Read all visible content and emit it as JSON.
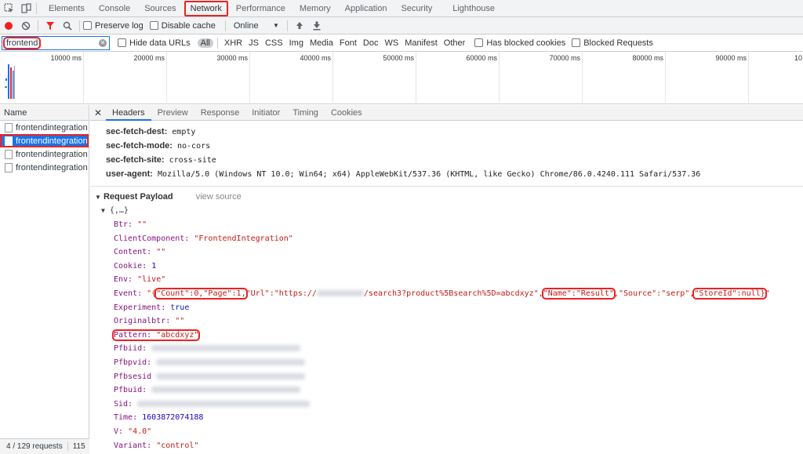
{
  "top_tabs": [
    "Elements",
    "Console",
    "Sources",
    "Network",
    "Performance",
    "Memory",
    "Application",
    "Security",
    "Lighthouse"
  ],
  "toolbar": {
    "preserve_log": "Preserve log",
    "disable_cache": "Disable cache",
    "throttle": "Online"
  },
  "filter": {
    "value": "frontend",
    "hide_data_urls": "Hide data URLs",
    "types": [
      "All",
      "XHR",
      "JS",
      "CSS",
      "Img",
      "Media",
      "Font",
      "Doc",
      "WS",
      "Manifest",
      "Other"
    ],
    "has_blocked_cookies": "Has blocked cookies",
    "blocked_requests": "Blocked Requests"
  },
  "timeline_ticks": [
    "10000 ms",
    "20000 ms",
    "30000 ms",
    "40000 ms",
    "50000 ms",
    "60000 ms",
    "70000 ms",
    "80000 ms",
    "90000 ms",
    "10"
  ],
  "requests": {
    "header": "Name",
    "items": [
      "frontendintegration",
      "frontendintegration",
      "frontendintegration",
      "frontendintegration"
    ],
    "selected_index": 1,
    "status": "4 / 129 requests",
    "status_more": "115"
  },
  "detail_tabs": [
    "Headers",
    "Preview",
    "Response",
    "Initiator",
    "Timing",
    "Cookies"
  ],
  "headers": [
    {
      "k": "sec-fetch-dest:",
      "v": "empty"
    },
    {
      "k": "sec-fetch-mode:",
      "v": "no-cors"
    },
    {
      "k": "sec-fetch-site:",
      "v": "cross-site"
    },
    {
      "k": "user-agent:",
      "v": "Mozilla/5.0 (Windows NT 10.0; Win64; x64) AppleWebKit/537.36 (KHTML, like Gecko) Chrome/86.0.4240.111 Safari/537.36"
    }
  ],
  "payload": {
    "title": "Request Payload",
    "view_source": "view source",
    "root": "{,…}",
    "btr_k": "Btr:",
    "btr_v": "\"\"",
    "cc_k": "ClientComponent:",
    "cc_v": "\"FrontendIntegration\"",
    "content_k": "Content:",
    "content_v": "\"\"",
    "cookie_k": "Cookie:",
    "cookie_v": "1",
    "env_k": "Env:",
    "env_v": "\"live\"",
    "event_k": "Event:",
    "event_a": "\"{",
    "event_b": "\"Count\":0,\"Page\":1,",
    "event_c": "\"Url\":\"https://",
    "event_d": "/search3?product%5Bsearch%5D=abcdxyz\",",
    "event_e": "\"Name\":\"Result\"",
    "event_f": ",\"Source\":\"serp\",",
    "event_g": "\"StoreId\":null}",
    "event_h": "\"",
    "exp_k": "Experiment:",
    "exp_v": "true",
    "orig_k": "Originalbtr:",
    "orig_v": "\"\"",
    "pat_k": "Pattern:",
    "pat_v": "\"abcdxyz\"",
    "pfbiid_k": "Pfbiid:",
    "pfbpvid_k": "Pfbpvid:",
    "pfbsesid_k": "Pfbsesid",
    "pfbuid_k": "Pfbuid:",
    "sid_k": "Sid:",
    "time_k": "Time:",
    "time_v": "1603872074188",
    "v_k": "V:",
    "v_v": "\"4.0\"",
    "variant_k": "Variant:",
    "variant_v": "\"control\""
  },
  "colors": {
    "accent": "#1a73e8",
    "highlight": "#e22222"
  }
}
